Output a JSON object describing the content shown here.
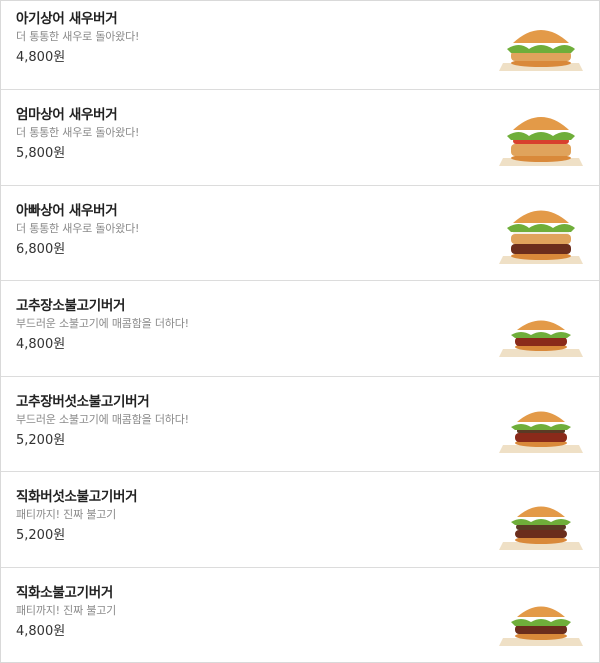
{
  "menu": {
    "items": [
      {
        "name": "아기상어 새우버거",
        "desc": "더 통통한 새우로 돌아왔다!",
        "price": "4,800원",
        "image": "shrimp-burger-image"
      },
      {
        "name": "엄마상어 새우버거",
        "desc": "더 통통한 새우로 돌아왔다!",
        "price": "5,800원",
        "image": "shrimp-burger-image"
      },
      {
        "name": "아빠상어 새우버거",
        "desc": "더 통통한 새우로 돌아왔다!",
        "price": "6,800원",
        "image": "shrimp-burger-image"
      },
      {
        "name": "고추장소불고기버거",
        "desc": "부드러운 소불고기에 매콤함을 더하다!",
        "price": "4,800원",
        "image": "bulgogi-burger-image"
      },
      {
        "name": "고추장버섯소불고기버거",
        "desc": "부드러운 소불고기에 매콤함을 더하다!",
        "price": "5,200원",
        "image": "bulgogi-burger-image"
      },
      {
        "name": "직화버섯소불고기버거",
        "desc": "패티까지! 진짜 불고기",
        "price": "5,200원",
        "image": "bulgogi-burger-image"
      },
      {
        "name": "직화소불고기버거",
        "desc": "패티까지! 진짜 불고기",
        "price": "4,800원",
        "image": "bulgogi-burger-image"
      }
    ]
  },
  "colors": {
    "bun": "#d9893a",
    "bun_top": "#e39a48",
    "lettuce": "#6fae3a",
    "patty": "#6b2d1c",
    "shrimp_patty": "#e0a35c",
    "tomato": "#d8402e",
    "box": "#efe0c6"
  }
}
